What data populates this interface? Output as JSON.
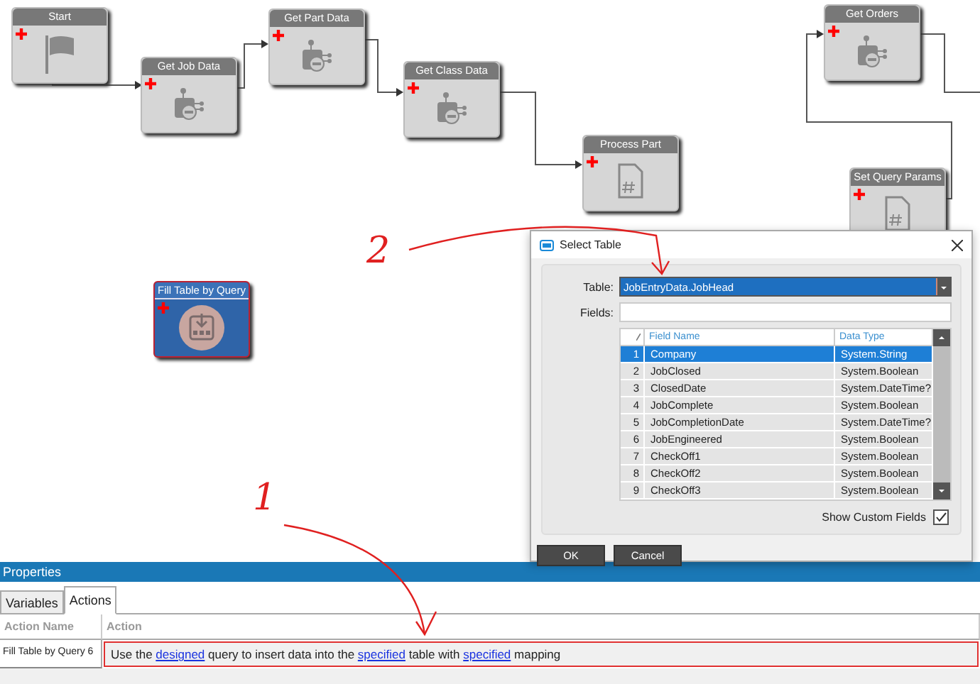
{
  "canvas": {
    "nodes": [
      {
        "title": "Start",
        "kind": "start",
        "selected": false
      },
      {
        "title": "Get Job Data",
        "kind": "query",
        "selected": false
      },
      {
        "title": "Get Part Data",
        "kind": "query",
        "selected": false
      },
      {
        "title": "Get Class Data",
        "kind": "query",
        "selected": false
      },
      {
        "title": "Process Part",
        "kind": "script",
        "selected": false
      },
      {
        "title": "Get Orders",
        "kind": "query",
        "selected": false
      },
      {
        "title": "Set Query Params",
        "kind": "script",
        "selected": false
      },
      {
        "title": "Fill Table by Query",
        "kind": "fill",
        "selected": true
      }
    ]
  },
  "annotations": [
    {
      "label": "2"
    },
    {
      "label": "1"
    }
  ],
  "dialog": {
    "title": "Select Table",
    "table_label": "Table:",
    "table_value": "JobEntryData.JobHead",
    "fields_label": "Fields:",
    "columns": [
      "Field Name",
      "Data Type"
    ],
    "rows": [
      {
        "index": "1",
        "field": "Company",
        "type": "System.String",
        "selected": true
      },
      {
        "index": "2",
        "field": "JobClosed",
        "type": "System.Boolean",
        "selected": false
      },
      {
        "index": "3",
        "field": "ClosedDate",
        "type": "System.DateTime?",
        "selected": false
      },
      {
        "index": "4",
        "field": "JobComplete",
        "type": "System.Boolean",
        "selected": false
      },
      {
        "index": "5",
        "field": "JobCompletionDate",
        "type": "System.DateTime?",
        "selected": false
      },
      {
        "index": "6",
        "field": "JobEngineered",
        "type": "System.Boolean",
        "selected": false
      },
      {
        "index": "7",
        "field": "CheckOff1",
        "type": "System.Boolean",
        "selected": false
      },
      {
        "index": "8",
        "field": "CheckOff2",
        "type": "System.Boolean",
        "selected": false
      },
      {
        "index": "9",
        "field": "CheckOff3",
        "type": "System.Boolean",
        "selected": false
      }
    ],
    "show_custom_fields": {
      "label": "Show Custom Fields",
      "checked": true
    },
    "buttons": [
      "OK",
      "Cancel"
    ]
  },
  "properties": {
    "title": "Properties",
    "tabs": [
      {
        "label": "Variables",
        "selected": false
      },
      {
        "label": "Actions",
        "selected": true
      }
    ],
    "columns": [
      "Action Name",
      "Action"
    ],
    "rows": [
      {
        "name": "Fill Table by Query 6",
        "action": [
          {
            "text": "Use the ",
            "link": false
          },
          {
            "text": "designed",
            "link": true
          },
          {
            "text": " query to insert data into the ",
            "link": false
          },
          {
            "text": "specified",
            "link": true
          },
          {
            "text": " table with ",
            "link": false
          },
          {
            "text": "specified",
            "link": true
          },
          {
            "text": " mapping",
            "link": false
          }
        ]
      }
    ]
  }
}
